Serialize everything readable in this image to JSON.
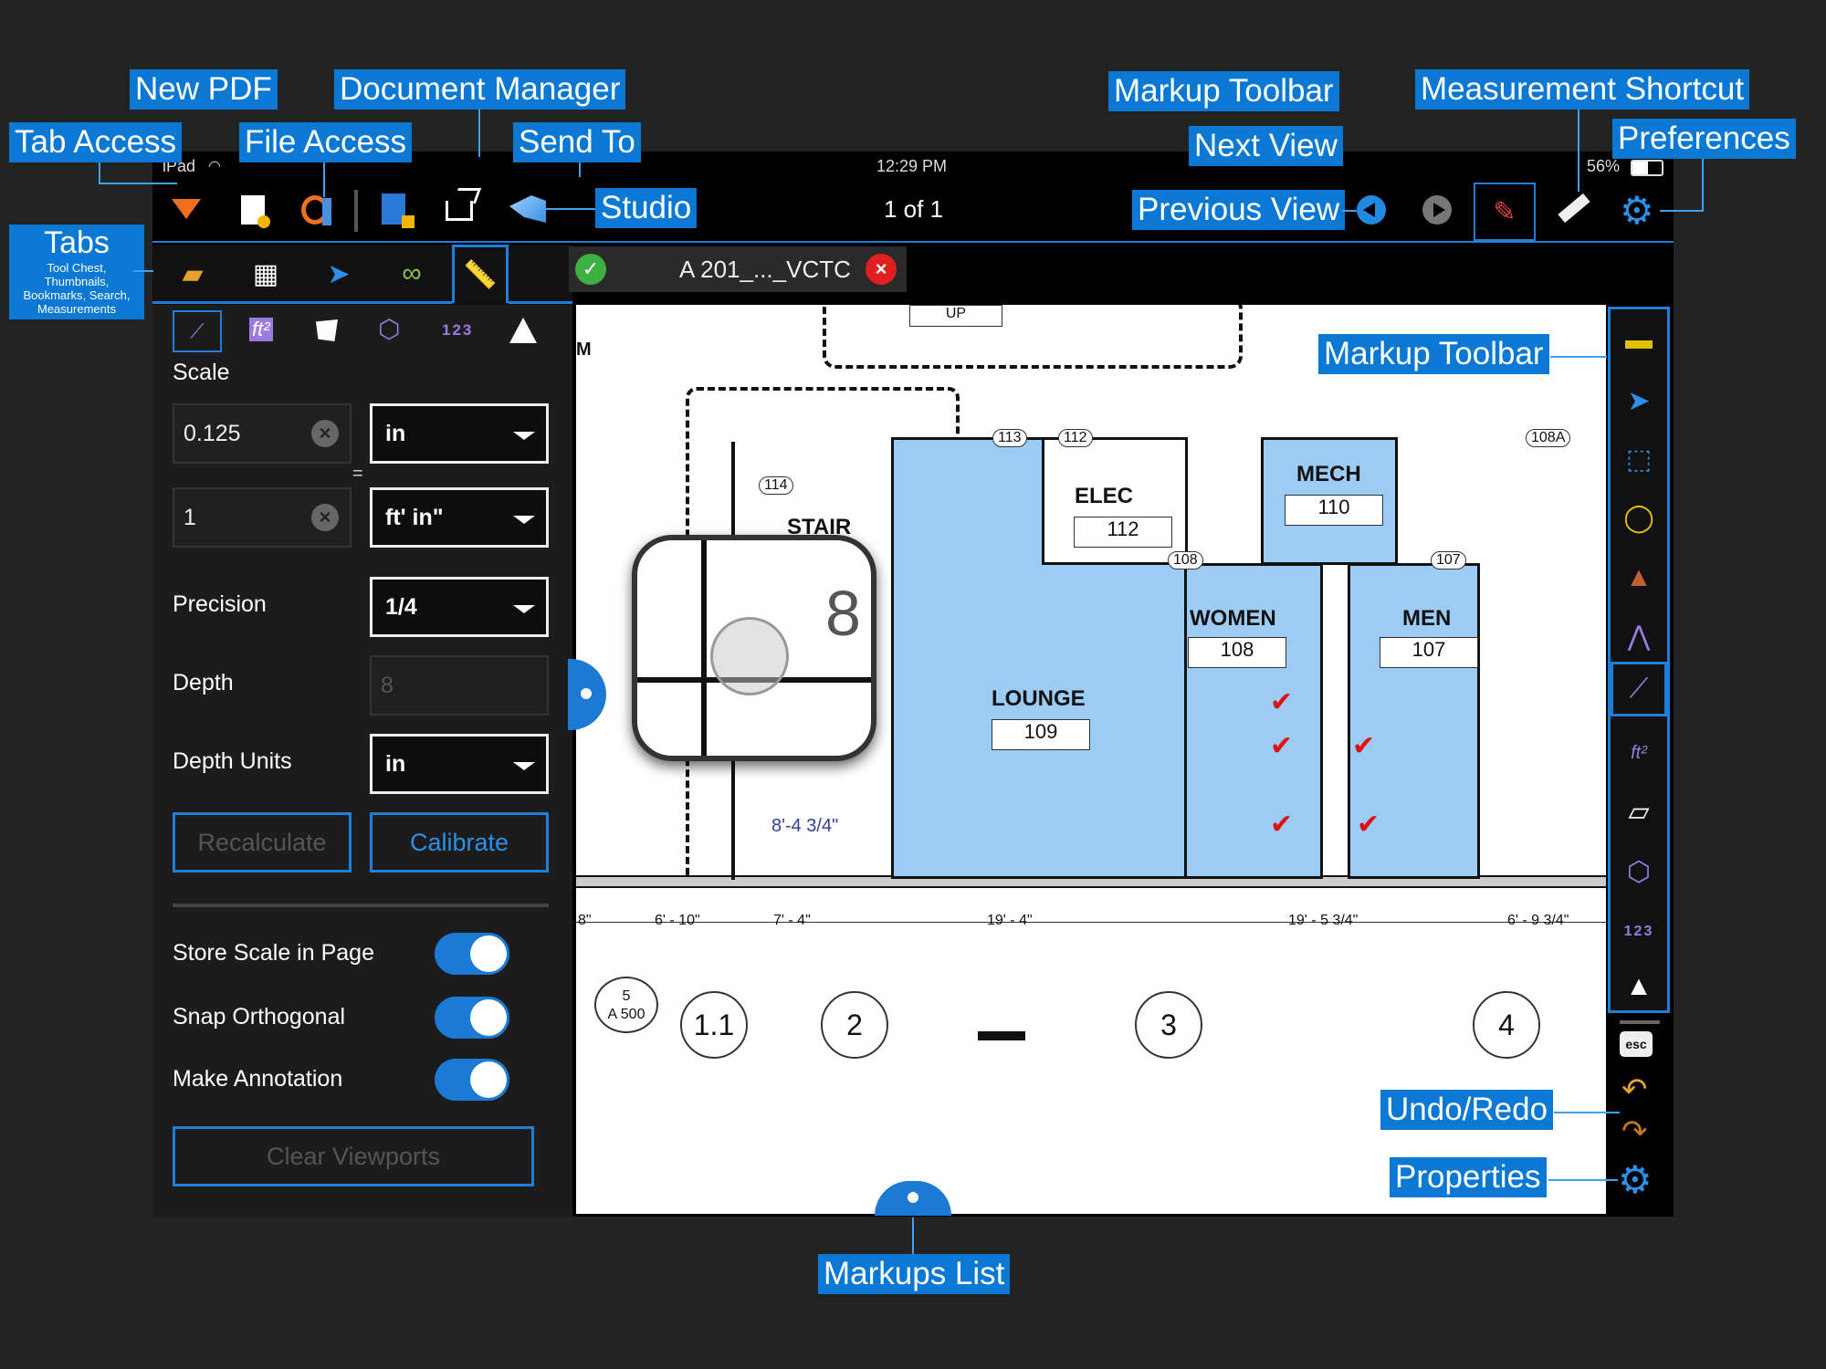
{
  "status_bar": {
    "device": "iPad",
    "time": "12:29 PM",
    "battery": "56%"
  },
  "top_bar": {
    "page_indicator": "1 of 1"
  },
  "document_tab": {
    "title": "A 201_..._VCTC"
  },
  "callouts": {
    "new_pdf": "New PDF",
    "document_manager": "Document Manager",
    "tab_access": "Tab Access",
    "file_access": "File Access",
    "send_to": "Send To",
    "studio": "Studio",
    "markup_toolbar_top": "Markup Toolbar",
    "measurement_shortcut": "Measurement Shortcut",
    "next_view": "Next View",
    "preferences": "Preferences",
    "previous_view": "Previous View",
    "tabs_title": "Tabs",
    "tabs_sub": "Tool Chest, Thumbnails, Bookmarks, Search, Measurements",
    "markup_toolbar_right": "Markup Toolbar",
    "undo_redo": "Undo/Redo",
    "properties": "Properties",
    "markups_list": "Markups List"
  },
  "measure_panel": {
    "tool_123": "123",
    "scale_label": "Scale",
    "scale_value_1": "0.125",
    "scale_unit_1": "in",
    "equals": "=",
    "scale_value_2": "1",
    "scale_unit_2": "ft' in\"",
    "precision_label": "Precision",
    "precision_value": "1/4",
    "depth_label": "Depth",
    "depth_placeholder": "8",
    "depth_units_label": "Depth Units",
    "depth_units_value": "in",
    "recalculate": "Recalculate",
    "calibrate": "Calibrate",
    "store_scale": "Store Scale in Page",
    "snap_orthogonal": "Snap Orthogonal",
    "make_annotation": "Make Annotation",
    "clear_viewports": "Clear Viewports",
    "toggles": {
      "store_scale": true,
      "snap_orthogonal": true,
      "make_annotation": true
    }
  },
  "plan": {
    "up": "UP",
    "m": "M",
    "stair": "STAIR",
    "rooms": [
      {
        "name": "ELEC",
        "number": "112"
      },
      {
        "name": "MECH",
        "number": "110"
      },
      {
        "name": "WOMEN",
        "number": "108"
      },
      {
        "name": "MEN",
        "number": "107"
      },
      {
        "name": "LOUNGE",
        "number": "109"
      }
    ],
    "door_tags": [
      "113",
      "112",
      "114",
      "108A",
      "108",
      "107"
    ],
    "magnifier_digit": "8",
    "measure_label": "8'-4 3/4\"",
    "dimensions": [
      "8\"",
      "6' - 10\"",
      "7' - 4\"",
      "19' - 4\"",
      "19' - 5 3/4\"",
      "6' - 9 3/4\""
    ],
    "section_ref": {
      "number": "5",
      "sheet": "A 500"
    },
    "grid_bubbles": [
      "1.1",
      "2",
      "3",
      "4"
    ]
  },
  "right_toolbar": {
    "tool_123": "123",
    "esc": "esc"
  },
  "colors": {
    "accent": "#0b78d4",
    "room_fill": "#9ccbf3",
    "toolbar_border": "#1f7fd8"
  }
}
